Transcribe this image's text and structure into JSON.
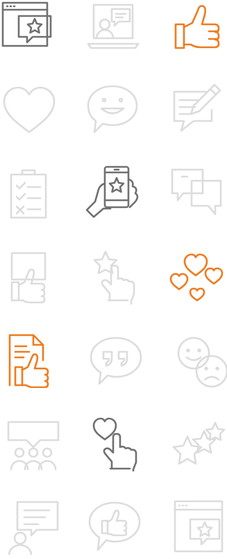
{
  "colors": {
    "dark": "#707070",
    "light": "#dcdcdc",
    "accent": "#f07a1e"
  },
  "icons": [
    {
      "name": "window-star-chat-icon",
      "tone": "dark"
    },
    {
      "name": "laptop-user-chat-icon",
      "tone": "light"
    },
    {
      "name": "thumbs-up-icon",
      "tone": "accent"
    },
    {
      "name": "heart-icon",
      "tone": "light"
    },
    {
      "name": "smile-speech-bubble-icon",
      "tone": "light"
    },
    {
      "name": "edit-speech-bubble-icon",
      "tone": "light"
    },
    {
      "name": "checklist-clipboard-icon",
      "tone": "light"
    },
    {
      "name": "hand-phone-star-icon",
      "tone": "dark"
    },
    {
      "name": "conversation-bubbles-icon",
      "tone": "light"
    },
    {
      "name": "phone-thumbs-up-icon",
      "tone": "light"
    },
    {
      "name": "hand-tap-star-icon",
      "tone": "light"
    },
    {
      "name": "floating-hearts-icon",
      "tone": "accent"
    },
    {
      "name": "document-thumbs-up-icon",
      "tone": "accent"
    },
    {
      "name": "quote-speech-bubble-icon",
      "tone": "light"
    },
    {
      "name": "happy-sad-faces-icon",
      "tone": "light"
    },
    {
      "name": "group-speech-bubble-icon",
      "tone": "light"
    },
    {
      "name": "hand-tap-heart-icon",
      "tone": "dark"
    },
    {
      "name": "stars-rating-icon",
      "tone": "light"
    },
    {
      "name": "user-speech-bubble-icon",
      "tone": "light"
    },
    {
      "name": "thumbs-up-speech-bubble-icon",
      "tone": "light"
    },
    {
      "name": "window-star-icon",
      "tone": "light"
    }
  ]
}
